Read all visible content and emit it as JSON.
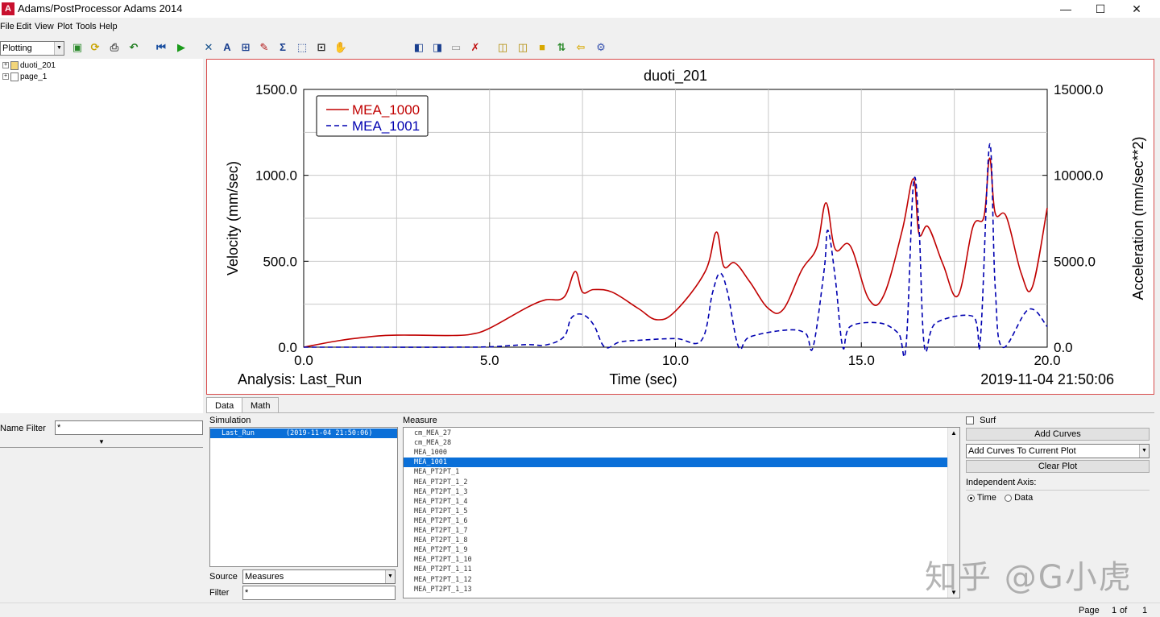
{
  "window": {
    "title": "Adams/PostProcessor Adams 2014",
    "icon_letter": "A",
    "minimize": "—",
    "maximize": "☐",
    "close": "✕"
  },
  "menu": [
    "File",
    "Edit",
    "View",
    "Plot",
    "Tools",
    "Help"
  ],
  "toolbar": {
    "mode_select": "Plotting",
    "icons": [
      "new-page-icon",
      "refresh-icon",
      "print-icon",
      "undo-icon",
      "rewind-icon",
      "play-icon",
      "axes-tool-icon",
      "text-tool-icon",
      "table-tool-icon",
      "curve-edit-icon",
      "sigma-icon",
      "zoom-box-icon",
      "fit-icon",
      "pan-hand-icon",
      "prev-page-icon",
      "next-page-icon",
      "paste-icon",
      "delete-page-icon",
      "layout-1-icon",
      "layout-2-icon",
      "layout-3-icon",
      "import-icon",
      "export-icon",
      "settings-icon"
    ]
  },
  "tree": {
    "items": [
      "duoti_201",
      "page_1"
    ]
  },
  "name_filter": {
    "label": "Name Filter",
    "value": "*"
  },
  "chart_data": {
    "type": "line",
    "title": "duoti_201",
    "xlabel": "Time (sec)",
    "ylabel": "Velocity (mm/sec)",
    "y2label": "Acceleration (mm/sec**2)",
    "xlim": [
      0,
      20
    ],
    "ylim": [
      0,
      1500
    ],
    "y2lim": [
      0,
      15000
    ],
    "xticks": [
      "0.0",
      "5.0",
      "10.0",
      "15.0",
      "20.0"
    ],
    "yticks": [
      "0.0",
      "500.0",
      "1000.0",
      "1500.0"
    ],
    "y2ticks": [
      "0.0",
      "5000.0",
      "10000.0",
      "15000.0"
    ],
    "grid": true,
    "legend_position": "top-left",
    "footer_left": "Analysis:  Last_Run",
    "footer_right": "2019-11-04 21:50:06",
    "series": [
      {
        "name": "MEA_1000",
        "color": "#c00000",
        "style": "solid",
        "axis": "left",
        "x": [
          0,
          1,
          2,
          2.5,
          3,
          4,
          4.5,
          5,
          6,
          6.5,
          7,
          7.3,
          7.5,
          7.8,
          8.3,
          9,
          9.5,
          10,
          10.8,
          11.1,
          11.3,
          11.6,
          12,
          12.5,
          12.9,
          13.4,
          13.8,
          14.05,
          14.3,
          14.7,
          15.2,
          15.6,
          16.1,
          16.4,
          16.55,
          16.8,
          17.2,
          17.6,
          18,
          18.3,
          18.45,
          18.6,
          18.9,
          19.3,
          19.6,
          20
        ],
        "y": [
          0,
          40,
          65,
          70,
          70,
          68,
          75,
          110,
          230,
          275,
          290,
          440,
          320,
          335,
          320,
          225,
          160,
          210,
          440,
          670,
          470,
          490,
          380,
          225,
          220,
          450,
          580,
          840,
          570,
          590,
          280,
          300,
          680,
          980,
          660,
          700,
          480,
          300,
          700,
          760,
          1100,
          780,
          760,
          430,
          350,
          810
        ]
      },
      {
        "name": "MEA_1001",
        "color": "#0000b0",
        "style": "dashed",
        "axis": "right",
        "x": [
          0,
          2,
          4,
          5,
          6,
          6.5,
          7,
          7.2,
          7.5,
          7.8,
          8.1,
          8.5,
          9,
          10,
          10.7,
          11,
          11.2,
          11.4,
          11.7,
          12,
          13,
          13.5,
          13.7,
          14,
          14.1,
          14.3,
          14.5,
          14.7,
          15.5,
          16,
          16.2,
          16.4,
          16.55,
          16.7,
          17,
          18,
          18.2,
          18.45,
          18.6,
          18.8,
          19.5,
          20
        ],
        "y": [
          0,
          0,
          0,
          20,
          150,
          120,
          600,
          1700,
          1900,
          1300,
          0,
          300,
          400,
          500,
          400,
          3200,
          4300,
          3200,
          0,
          600,
          1000,
          800,
          0,
          4500,
          6800,
          4000,
          0,
          1200,
          1400,
          800,
          0,
          9500,
          7000,
          0,
          1400,
          1800,
          400,
          11800,
          3500,
          0,
          2200,
          1200
        ]
      }
    ]
  },
  "tabs": [
    "Data",
    "Math"
  ],
  "simulation": {
    "label": "Simulation",
    "items": [
      {
        "name": "Last_Run",
        "time": "(2019-11-04 21:50:06)"
      }
    ]
  },
  "source": {
    "label": "Source",
    "value": "Measures"
  },
  "filter": {
    "label": "Filter",
    "value": "*"
  },
  "measure": {
    "label": "Measure",
    "items": [
      "cm_MEA_27",
      "cm_MEA_28",
      "MEA_1000",
      "MEA_1001",
      "MEA_PT2PT_1",
      "MEA_PT2PT_1_2",
      "MEA_PT2PT_1_3",
      "MEA_PT2PT_1_4",
      "MEA_PT2PT_1_5",
      "MEA_PT2PT_1_6",
      "MEA_PT2PT_1_7",
      "MEA_PT2PT_1_8",
      "MEA_PT2PT_1_9",
      "MEA_PT2PT_1_10",
      "MEA_PT2PT_1_11",
      "MEA_PT2PT_1_12",
      "MEA_PT2PT_1_13"
    ],
    "selected": "MEA_1001"
  },
  "right_panel": {
    "surf_label": "Surf",
    "add_curves": "Add Curves",
    "add_mode": "Add Curves To Current Plot",
    "clear_plot": "Clear Plot",
    "independent_axis_label": "Independent Axis:",
    "time_option": "Time",
    "data_option": "Data"
  },
  "status": {
    "page_label": "Page",
    "page_current": "1",
    "page_of": "of",
    "page_total": "1"
  },
  "watermark": "知乎 @G小虎"
}
